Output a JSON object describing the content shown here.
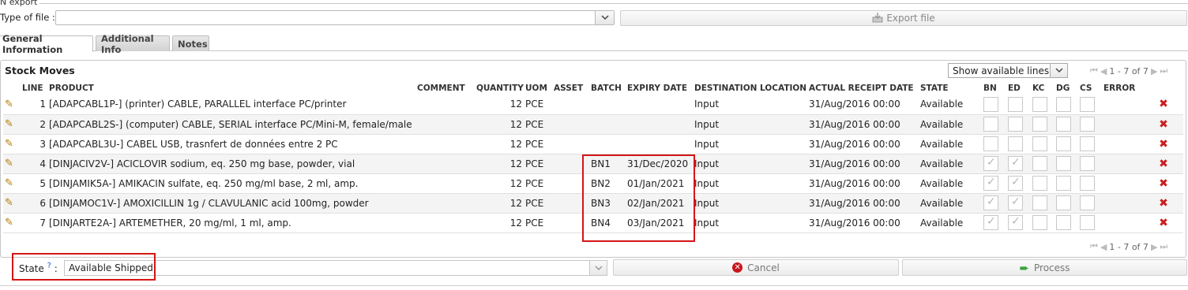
{
  "export": {
    "legend": "N export",
    "type_label": "Type of file :",
    "type_value": "",
    "export_button": "Export file"
  },
  "tabs": [
    {
      "label": "General Information"
    },
    {
      "label": "Additional Info"
    },
    {
      "label": "Notes"
    }
  ],
  "stock_moves": {
    "title": "Stock Moves",
    "filter_value": "Show available lines",
    "pager_text": "1 - 7 of 7",
    "columns": [
      "LINE",
      "PRODUCT",
      "COMMENT",
      "QUANTITY",
      "UOM",
      "ASSET",
      "BATCH",
      "EXPIRY DATE",
      "DESTINATION LOCATION",
      "ACTUAL RECEIPT DATE",
      "STATE",
      "BN",
      "ED",
      "KC",
      "DG",
      "CS",
      "ERROR"
    ],
    "rows": [
      {
        "line": "1",
        "product": "[ADAPCABL1P-] (printer) CABLE, PARALLEL interface PC/printer",
        "comment": "",
        "quantity": "12",
        "uom": "PCE",
        "asset": "",
        "batch": "",
        "expiry": "",
        "destination": "Input",
        "receipt": "31/Aug/2016 00:00",
        "state": "Available",
        "bn": false,
        "ed": false
      },
      {
        "line": "2",
        "product": "[ADAPCABL2S-] (computer) CABLE, SERIAL interface PC/Mini-M, female/male",
        "comment": "",
        "quantity": "12",
        "uom": "PCE",
        "asset": "",
        "batch": "",
        "expiry": "",
        "destination": "Input",
        "receipt": "31/Aug/2016 00:00",
        "state": "Available",
        "bn": false,
        "ed": false
      },
      {
        "line": "3",
        "product": "[ADAPCABL3U-] CABEL USB, trasnfert de données entre 2 PC",
        "comment": "",
        "quantity": "12",
        "uom": "PCE",
        "asset": "",
        "batch": "",
        "expiry": "",
        "destination": "Input",
        "receipt": "31/Aug/2016 00:00",
        "state": "Available",
        "bn": false,
        "ed": false
      },
      {
        "line": "4",
        "product": "[DINJACIV2V-] ACICLOVIR sodium, eq. 250 mg base, powder, vial",
        "comment": "",
        "quantity": "12",
        "uom": "PCE",
        "asset": "",
        "batch": "BN1",
        "expiry": "31/Dec/2020",
        "destination": "Input",
        "receipt": "31/Aug/2016 00:00",
        "state": "Available",
        "bn": true,
        "ed": true
      },
      {
        "line": "5",
        "product": "[DINJAMIK5A-] AMIKACIN sulfate, eq. 250 mg/ml base, 2 ml, amp.",
        "comment": "",
        "quantity": "12",
        "uom": "PCE",
        "asset": "",
        "batch": "BN2",
        "expiry": "01/Jan/2021",
        "destination": "Input",
        "receipt": "31/Aug/2016 00:00",
        "state": "Available",
        "bn": true,
        "ed": true
      },
      {
        "line": "6",
        "product": "[DINJAMOC1V-] AMOXICILLIN 1g / CLAVULANIC acid 100mg, powder",
        "comment": "",
        "quantity": "12",
        "uom": "PCE",
        "asset": "",
        "batch": "BN3",
        "expiry": "02/Jan/2021",
        "destination": "Input",
        "receipt": "31/Aug/2016 00:00",
        "state": "Available",
        "bn": true,
        "ed": true
      },
      {
        "line": "7",
        "product": "[DINJARTE2A-] ARTEMETHER, 20 mg/ml, 1 ml, amp.",
        "comment": "",
        "quantity": "12",
        "uom": "PCE",
        "asset": "",
        "batch": "BN4",
        "expiry": "03/Jan/2021",
        "destination": "Input",
        "receipt": "31/Aug/2016 00:00",
        "state": "Available",
        "bn": true,
        "ed": true
      }
    ]
  },
  "footer": {
    "state_label": "State",
    "state_help": "?",
    "state_colon": ":",
    "state_value": "Available Shipped",
    "cancel_label": "Cancel",
    "process_label": "Process"
  },
  "colors": {
    "highlight": "#d51515",
    "delete": "#cc1c1c",
    "process_green": "#3aa53a"
  }
}
